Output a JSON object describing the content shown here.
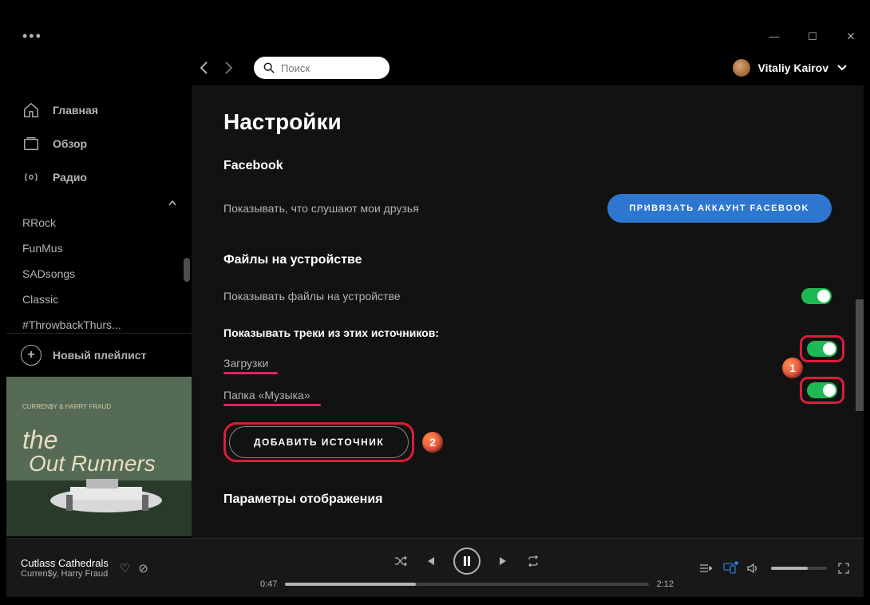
{
  "window": {
    "minimize": "—",
    "maximize": "☐",
    "close": "✕"
  },
  "search": {
    "placeholder": "Поиск"
  },
  "user": {
    "name": "Vitaliy Kairov"
  },
  "sidebar": {
    "nav": [
      {
        "label": "Главная",
        "icon": "home"
      },
      {
        "label": "Обзор",
        "icon": "browse"
      },
      {
        "label": "Радио",
        "icon": "radio"
      }
    ],
    "playlists": [
      "RRock",
      "FunMus",
      "SADsongs",
      "Classic",
      "#ThrowbackThurs..."
    ],
    "new_playlist": "Новый плейлист"
  },
  "settings": {
    "title": "Настройки",
    "facebook": {
      "heading": "Facebook",
      "label": "Показывать, что слушают мои друзья",
      "button": "ПРИВЯЗАТЬ АККАУНТ FACEBOOK"
    },
    "local": {
      "heading": "Файлы на устройстве",
      "show_label": "Показывать файлы на устройстве",
      "sources_label": "Показывать треки из этих источников:",
      "sources": [
        {
          "label": "Загрузки",
          "on": true
        },
        {
          "label": "Папка «Музыка»",
          "on": true
        }
      ],
      "add_button": "ДОБАВИТЬ ИСТОЧНИК"
    },
    "display": {
      "heading": "Параметры отображения"
    }
  },
  "annotations": {
    "badge1": "1",
    "badge2": "2"
  },
  "player": {
    "title": "Cutlass Cathedrals",
    "artist": "Curren$y, Harry Fraud",
    "elapsed": "0:47",
    "total": "2:12"
  }
}
